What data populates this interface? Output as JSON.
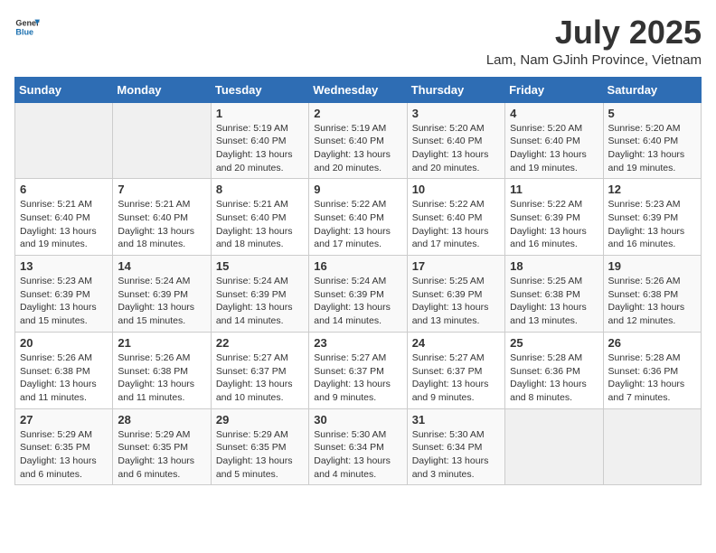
{
  "logo": {
    "text_general": "General",
    "text_blue": "Blue"
  },
  "header": {
    "month_year": "July 2025",
    "location": "Lam, Nam GJinh Province, Vietnam"
  },
  "weekdays": [
    "Sunday",
    "Monday",
    "Tuesday",
    "Wednesday",
    "Thursday",
    "Friday",
    "Saturday"
  ],
  "weeks": [
    [
      {
        "day": "",
        "sunrise": "",
        "sunset": "",
        "daylight": ""
      },
      {
        "day": "",
        "sunrise": "",
        "sunset": "",
        "daylight": ""
      },
      {
        "day": "1",
        "sunrise": "Sunrise: 5:19 AM",
        "sunset": "Sunset: 6:40 PM",
        "daylight": "Daylight: 13 hours and 20 minutes."
      },
      {
        "day": "2",
        "sunrise": "Sunrise: 5:19 AM",
        "sunset": "Sunset: 6:40 PM",
        "daylight": "Daylight: 13 hours and 20 minutes."
      },
      {
        "day": "3",
        "sunrise": "Sunrise: 5:20 AM",
        "sunset": "Sunset: 6:40 PM",
        "daylight": "Daylight: 13 hours and 20 minutes."
      },
      {
        "day": "4",
        "sunrise": "Sunrise: 5:20 AM",
        "sunset": "Sunset: 6:40 PM",
        "daylight": "Daylight: 13 hours and 19 minutes."
      },
      {
        "day": "5",
        "sunrise": "Sunrise: 5:20 AM",
        "sunset": "Sunset: 6:40 PM",
        "daylight": "Daylight: 13 hours and 19 minutes."
      }
    ],
    [
      {
        "day": "6",
        "sunrise": "Sunrise: 5:21 AM",
        "sunset": "Sunset: 6:40 PM",
        "daylight": "Daylight: 13 hours and 19 minutes."
      },
      {
        "day": "7",
        "sunrise": "Sunrise: 5:21 AM",
        "sunset": "Sunset: 6:40 PM",
        "daylight": "Daylight: 13 hours and 18 minutes."
      },
      {
        "day": "8",
        "sunrise": "Sunrise: 5:21 AM",
        "sunset": "Sunset: 6:40 PM",
        "daylight": "Daylight: 13 hours and 18 minutes."
      },
      {
        "day": "9",
        "sunrise": "Sunrise: 5:22 AM",
        "sunset": "Sunset: 6:40 PM",
        "daylight": "Daylight: 13 hours and 17 minutes."
      },
      {
        "day": "10",
        "sunrise": "Sunrise: 5:22 AM",
        "sunset": "Sunset: 6:40 PM",
        "daylight": "Daylight: 13 hours and 17 minutes."
      },
      {
        "day": "11",
        "sunrise": "Sunrise: 5:22 AM",
        "sunset": "Sunset: 6:39 PM",
        "daylight": "Daylight: 13 hours and 16 minutes."
      },
      {
        "day": "12",
        "sunrise": "Sunrise: 5:23 AM",
        "sunset": "Sunset: 6:39 PM",
        "daylight": "Daylight: 13 hours and 16 minutes."
      }
    ],
    [
      {
        "day": "13",
        "sunrise": "Sunrise: 5:23 AM",
        "sunset": "Sunset: 6:39 PM",
        "daylight": "Daylight: 13 hours and 15 minutes."
      },
      {
        "day": "14",
        "sunrise": "Sunrise: 5:24 AM",
        "sunset": "Sunset: 6:39 PM",
        "daylight": "Daylight: 13 hours and 15 minutes."
      },
      {
        "day": "15",
        "sunrise": "Sunrise: 5:24 AM",
        "sunset": "Sunset: 6:39 PM",
        "daylight": "Daylight: 13 hours and 14 minutes."
      },
      {
        "day": "16",
        "sunrise": "Sunrise: 5:24 AM",
        "sunset": "Sunset: 6:39 PM",
        "daylight": "Daylight: 13 hours and 14 minutes."
      },
      {
        "day": "17",
        "sunrise": "Sunrise: 5:25 AM",
        "sunset": "Sunset: 6:39 PM",
        "daylight": "Daylight: 13 hours and 13 minutes."
      },
      {
        "day": "18",
        "sunrise": "Sunrise: 5:25 AM",
        "sunset": "Sunset: 6:38 PM",
        "daylight": "Daylight: 13 hours and 13 minutes."
      },
      {
        "day": "19",
        "sunrise": "Sunrise: 5:26 AM",
        "sunset": "Sunset: 6:38 PM",
        "daylight": "Daylight: 13 hours and 12 minutes."
      }
    ],
    [
      {
        "day": "20",
        "sunrise": "Sunrise: 5:26 AM",
        "sunset": "Sunset: 6:38 PM",
        "daylight": "Daylight: 13 hours and 11 minutes."
      },
      {
        "day": "21",
        "sunrise": "Sunrise: 5:26 AM",
        "sunset": "Sunset: 6:38 PM",
        "daylight": "Daylight: 13 hours and 11 minutes."
      },
      {
        "day": "22",
        "sunrise": "Sunrise: 5:27 AM",
        "sunset": "Sunset: 6:37 PM",
        "daylight": "Daylight: 13 hours and 10 minutes."
      },
      {
        "day": "23",
        "sunrise": "Sunrise: 5:27 AM",
        "sunset": "Sunset: 6:37 PM",
        "daylight": "Daylight: 13 hours and 9 minutes."
      },
      {
        "day": "24",
        "sunrise": "Sunrise: 5:27 AM",
        "sunset": "Sunset: 6:37 PM",
        "daylight": "Daylight: 13 hours and 9 minutes."
      },
      {
        "day": "25",
        "sunrise": "Sunrise: 5:28 AM",
        "sunset": "Sunset: 6:36 PM",
        "daylight": "Daylight: 13 hours and 8 minutes."
      },
      {
        "day": "26",
        "sunrise": "Sunrise: 5:28 AM",
        "sunset": "Sunset: 6:36 PM",
        "daylight": "Daylight: 13 hours and 7 minutes."
      }
    ],
    [
      {
        "day": "27",
        "sunrise": "Sunrise: 5:29 AM",
        "sunset": "Sunset: 6:35 PM",
        "daylight": "Daylight: 13 hours and 6 minutes."
      },
      {
        "day": "28",
        "sunrise": "Sunrise: 5:29 AM",
        "sunset": "Sunset: 6:35 PM",
        "daylight": "Daylight: 13 hours and 6 minutes."
      },
      {
        "day": "29",
        "sunrise": "Sunrise: 5:29 AM",
        "sunset": "Sunset: 6:35 PM",
        "daylight": "Daylight: 13 hours and 5 minutes."
      },
      {
        "day": "30",
        "sunrise": "Sunrise: 5:30 AM",
        "sunset": "Sunset: 6:34 PM",
        "daylight": "Daylight: 13 hours and 4 minutes."
      },
      {
        "day": "31",
        "sunrise": "Sunrise: 5:30 AM",
        "sunset": "Sunset: 6:34 PM",
        "daylight": "Daylight: 13 hours and 3 minutes."
      },
      {
        "day": "",
        "sunrise": "",
        "sunset": "",
        "daylight": ""
      },
      {
        "day": "",
        "sunrise": "",
        "sunset": "",
        "daylight": ""
      }
    ]
  ]
}
